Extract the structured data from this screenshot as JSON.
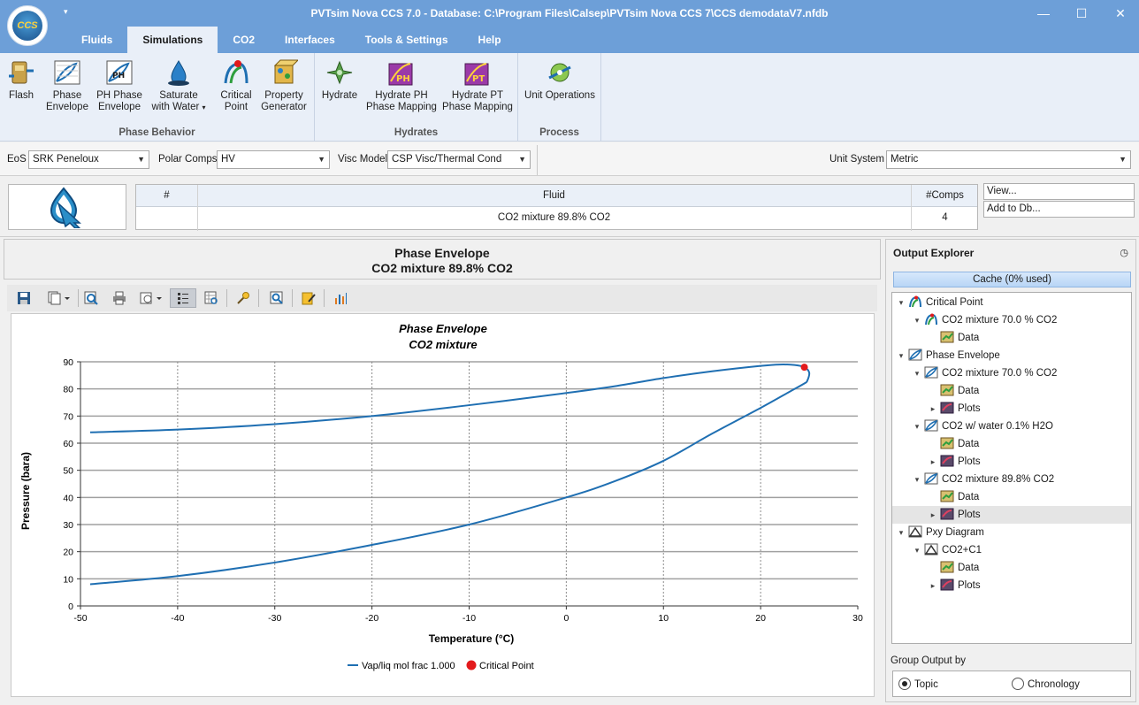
{
  "window": {
    "title": "PVTsim Nova CCS 7.0 - Database: C:\\Program Files\\Calsep\\PVTsim Nova CCS 7\\CCS demodataV7.nfdb",
    "logo_text": "CCS"
  },
  "tabs": [
    {
      "label": "Fluids"
    },
    {
      "label": "Simulations"
    },
    {
      "label": "CO2"
    },
    {
      "label": "Interfaces"
    },
    {
      "label": "Tools & Settings"
    },
    {
      "label": "Help"
    }
  ],
  "ribbon": {
    "phase_behavior": {
      "label": "Phase Behavior",
      "buttons": [
        {
          "label1": "Flash",
          "label2": ""
        },
        {
          "label1": "Phase",
          "label2": "Envelope"
        },
        {
          "label1": "PH Phase",
          "label2": "Envelope"
        },
        {
          "label1": "Saturate",
          "label2": "with Water"
        },
        {
          "label1": "Critical",
          "label2": "Point"
        },
        {
          "label1": "Property",
          "label2": "Generator"
        }
      ]
    },
    "hydrates": {
      "label": "Hydrates",
      "buttons": [
        {
          "label1": "Hydrate",
          "label2": ""
        },
        {
          "label1": "Hydrate PH",
          "label2": "Phase Mapping"
        },
        {
          "label1": "Hydrate PT",
          "label2": "Phase Mapping"
        }
      ]
    },
    "process": {
      "label": "Process",
      "buttons": [
        {
          "label1": "Unit Operations",
          "label2": ""
        }
      ]
    }
  },
  "options": {
    "eos_label": "EoS",
    "eos_value": "SRK Peneloux",
    "polar_label": "Polar Comps",
    "polar_value": "HV",
    "visc_label": "Visc Model",
    "visc_value": "CSP Visc/Thermal Cond",
    "unit_label": "Unit System",
    "unit_value": "Metric"
  },
  "fluid_table": {
    "headers": {
      "num": "#",
      "fluid": "Fluid",
      "comps": "#Comps"
    },
    "row": {
      "num": "",
      "fluid": "CO2 mixture 89.8% CO2",
      "comps": "4"
    },
    "view_button": "View...",
    "add_button": "Add to Db..."
  },
  "plot": {
    "header_line1": "Phase Envelope",
    "header_line2": "CO2 mixture 89.8% CO2"
  },
  "chart_data": {
    "type": "line",
    "title": "Phase Envelope",
    "subtitle": "CO2 mixture",
    "xlabel": "Temperature (°C)",
    "ylabel": "Pressure (bara)",
    "xlim": [
      -50,
      30
    ],
    "ylim": [
      0,
      90
    ],
    "x_ticks": [
      -50,
      -40,
      -30,
      -20,
      -10,
      0,
      10,
      20,
      30
    ],
    "y_ticks": [
      0,
      10,
      20,
      30,
      40,
      50,
      60,
      70,
      80,
      90
    ],
    "grid": true,
    "legend_position": "bottom",
    "series": [
      {
        "name": "Vap/liq mol frac 1.000",
        "color": "#1f6fb2",
        "x": [
          -49,
          -40,
          -30,
          -20,
          -10,
          0,
          5,
          10,
          15,
          20,
          22,
          23.5,
          24.5,
          25,
          24.8,
          24.5,
          23,
          20,
          15,
          10,
          5,
          0,
          -10,
          -20,
          -30,
          -40,
          -49
        ],
        "y": [
          64,
          65,
          67,
          70,
          74,
          78.5,
          81,
          84,
          86.5,
          88.5,
          89,
          88.8,
          88,
          86,
          83,
          82,
          79,
          73,
          63.5,
          53.5,
          46,
          40,
          30,
          22.5,
          16,
          11,
          8
        ]
      },
      {
        "name": "Critical Point",
        "color": "#e31a1c",
        "x": [
          24.5
        ],
        "y": [
          88
        ]
      }
    ]
  },
  "explorer": {
    "title": "Output Explorer",
    "cache": "Cache (0% used)",
    "group_label": "Group Output by",
    "radio_topic": "Topic",
    "radio_chronology": "Chronology",
    "nodes": [
      {
        "label": "Critical Point",
        "icon": "critical-point-icon"
      },
      {
        "label": "CO2 mixture 70.0 % CO2",
        "icon": "critical-point-icon"
      },
      {
        "label": "Data",
        "icon": "data-icon"
      },
      {
        "label": "Phase Envelope",
        "icon": "phase-envelope-icon"
      },
      {
        "label": "CO2 mixture 70.0 % CO2",
        "icon": "phase-envelope-icon"
      },
      {
        "label": "Data",
        "icon": "data-icon"
      },
      {
        "label": "Plots",
        "icon": "plots-icon"
      },
      {
        "label": "CO2 w/ water 0.1% H2O",
        "icon": "phase-envelope-icon"
      },
      {
        "label": "Data",
        "icon": "data-icon"
      },
      {
        "label": "Plots",
        "icon": "plots-icon"
      },
      {
        "label": "CO2 mixture 89.8% CO2",
        "icon": "phase-envelope-icon"
      },
      {
        "label": "Data",
        "icon": "data-icon"
      },
      {
        "label": "Plots",
        "icon": "plots-icon"
      },
      {
        "label": "Pxy Diagram",
        "icon": "pxy-diagram-icon"
      },
      {
        "label": "CO2+C1",
        "icon": "pxy-diagram-icon"
      },
      {
        "label": "Data",
        "icon": "data-icon"
      },
      {
        "label": "Plots",
        "icon": "plots-icon"
      }
    ]
  }
}
